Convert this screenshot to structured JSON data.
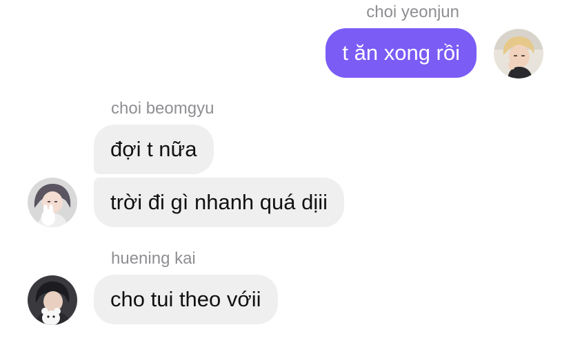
{
  "thread": {
    "groups": [
      {
        "sender": "choi yeonjun",
        "direction": "outgoing",
        "avatar_icon": "user-photo-icon",
        "messages": [
          "t ăn xong rồi"
        ]
      },
      {
        "sender": "choi beomgyu",
        "direction": "incoming",
        "avatar_icon": "user-photo-icon",
        "messages": [
          "đợi t nữa",
          "trời đi gì nhanh quá dịii"
        ]
      },
      {
        "sender": "huening kai",
        "direction": "incoming",
        "avatar_icon": "user-photo-icon",
        "messages": [
          "cho tui theo vớii"
        ]
      }
    ]
  },
  "colors": {
    "outgoing_bubble": "#7b5cf5",
    "incoming_bubble": "#efefef",
    "sender_label": "#8e8e93"
  }
}
